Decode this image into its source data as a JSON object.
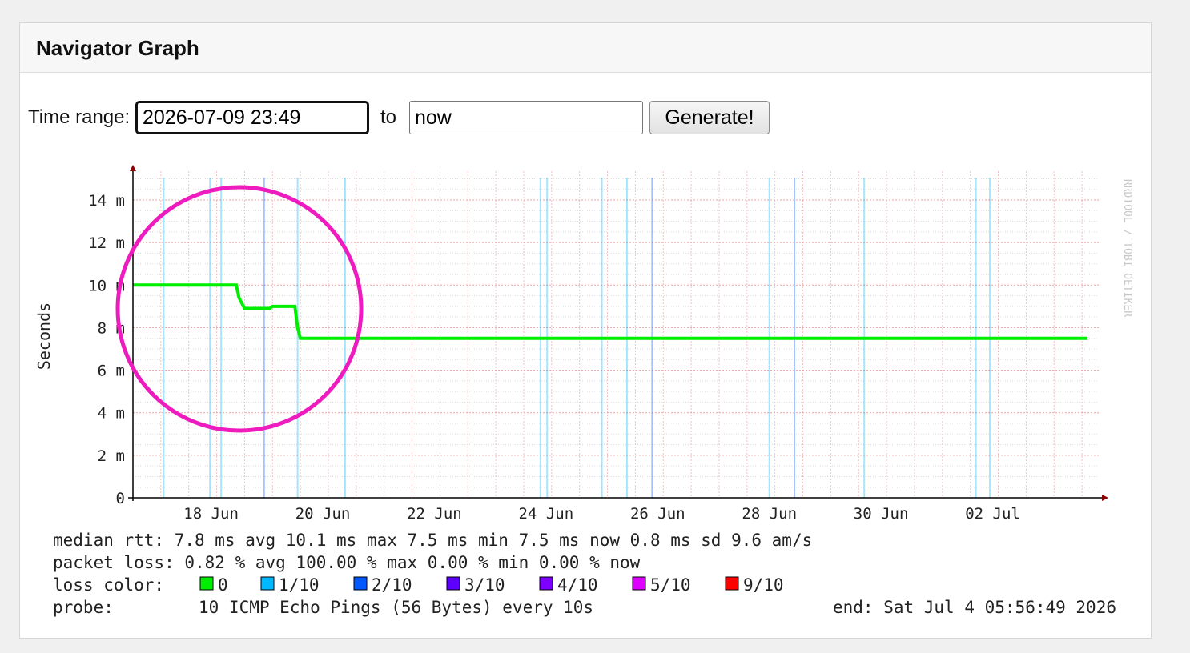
{
  "panel": {
    "title": "Navigator Graph"
  },
  "form": {
    "time_range_label": "Time range:",
    "start_value": "2026-07-09 23:49",
    "to_label": "to",
    "end_value": "now",
    "generate_label": "Generate!"
  },
  "colors": {
    "green_median": "#00ee00",
    "loss_1": "#00b8ff",
    "loss_2": "#0059ff",
    "loss_3": "#5e00ff",
    "loss_4": "#7e00ff",
    "loss_5": "#dd00ff",
    "loss_9": "#ff0000",
    "annotation_circle": "#ee1cbe"
  },
  "chart_data": {
    "type": "line",
    "ylabel": "Seconds",
    "watermark": "RRDTOOL / TOBI OETIKER",
    "x_unit": "days since 16 Jun",
    "xlim": [
      0,
      17.3
    ],
    "ylim": [
      0,
      15
    ],
    "y_ticks": [
      {
        "value": 0,
        "label": "0"
      },
      {
        "value": 2,
        "label": "2 m"
      },
      {
        "value": 4,
        "label": "4 m"
      },
      {
        "value": 6,
        "label": "6 m"
      },
      {
        "value": 8,
        "label": "8 m"
      },
      {
        "value": 10,
        "label": "10 m"
      },
      {
        "value": 12,
        "label": "12 m"
      },
      {
        "value": 14,
        "label": "14 m"
      }
    ],
    "x_ticks": [
      {
        "value": 1.4,
        "label": "18 Jun"
      },
      {
        "value": 3.4,
        "label": "20 Jun"
      },
      {
        "value": 5.4,
        "label": "22 Jun"
      },
      {
        "value": 7.4,
        "label": "24 Jun"
      },
      {
        "value": 9.4,
        "label": "26 Jun"
      },
      {
        "value": 11.4,
        "label": "28 Jun"
      },
      {
        "value": 13.4,
        "label": "30 Jun"
      },
      {
        "value": 15.4,
        "label": "02 Jul"
      }
    ],
    "series": [
      {
        "name": "median rtt",
        "x": [
          0,
          1.85,
          1.9,
          2.0,
          2.45,
          2.5,
          2.9,
          2.95,
          3.0,
          17.1
        ],
        "y": [
          10.0,
          10.0,
          9.4,
          8.9,
          8.9,
          9.0,
          9.0,
          8.0,
          7.5,
          7.5
        ]
      }
    ],
    "loss_markers": [
      {
        "x": 0.55,
        "level": "1/10"
      },
      {
        "x": 1.38,
        "level": "1/10"
      },
      {
        "x": 1.58,
        "level": "1/10"
      },
      {
        "x": 2.35,
        "level": "2/10"
      },
      {
        "x": 2.95,
        "level": "1/10"
      },
      {
        "x": 3.8,
        "level": "1/10"
      },
      {
        "x": 7.3,
        "level": "1/10"
      },
      {
        "x": 7.42,
        "level": "1/10"
      },
      {
        "x": 8.4,
        "level": "1/10"
      },
      {
        "x": 8.85,
        "level": "1/10"
      },
      {
        "x": 9.3,
        "level": "2/10"
      },
      {
        "x": 11.4,
        "level": "1/10"
      },
      {
        "x": 11.85,
        "level": "2/10"
      },
      {
        "x": 13.1,
        "level": "1/10"
      },
      {
        "x": 15.1,
        "level": "1/10"
      },
      {
        "x": 15.35,
        "level": "1/10"
      }
    ],
    "legend": {
      "rows": [
        "median rtt:  7.8 ms avg  10.1 ms max  7.5 ms min  7.5 ms now  0.8 ms sd  9.6   am/s",
        "packet loss: 0.82 % avg  100.00 % max  0.00 % min  0.00 % now"
      ],
      "loss_color_label": "loss color:",
      "loss_colors": [
        {
          "label": "0",
          "color": "#00ee00"
        },
        {
          "label": "1/10",
          "color": "#00b8ff"
        },
        {
          "label": "2/10",
          "color": "#0059ff"
        },
        {
          "label": "3/10",
          "color": "#5e00ff"
        },
        {
          "label": "4/10",
          "color": "#7e00ff"
        },
        {
          "label": "5/10",
          "color": "#dd00ff"
        },
        {
          "label": "9/10",
          "color": "#ff0000"
        }
      ],
      "probe_label": "probe:",
      "probe_value": "10 ICMP Echo Pings (56 Bytes) every 10s",
      "end_label": "end: Sat Jul  4 05:56:49 2026"
    }
  }
}
